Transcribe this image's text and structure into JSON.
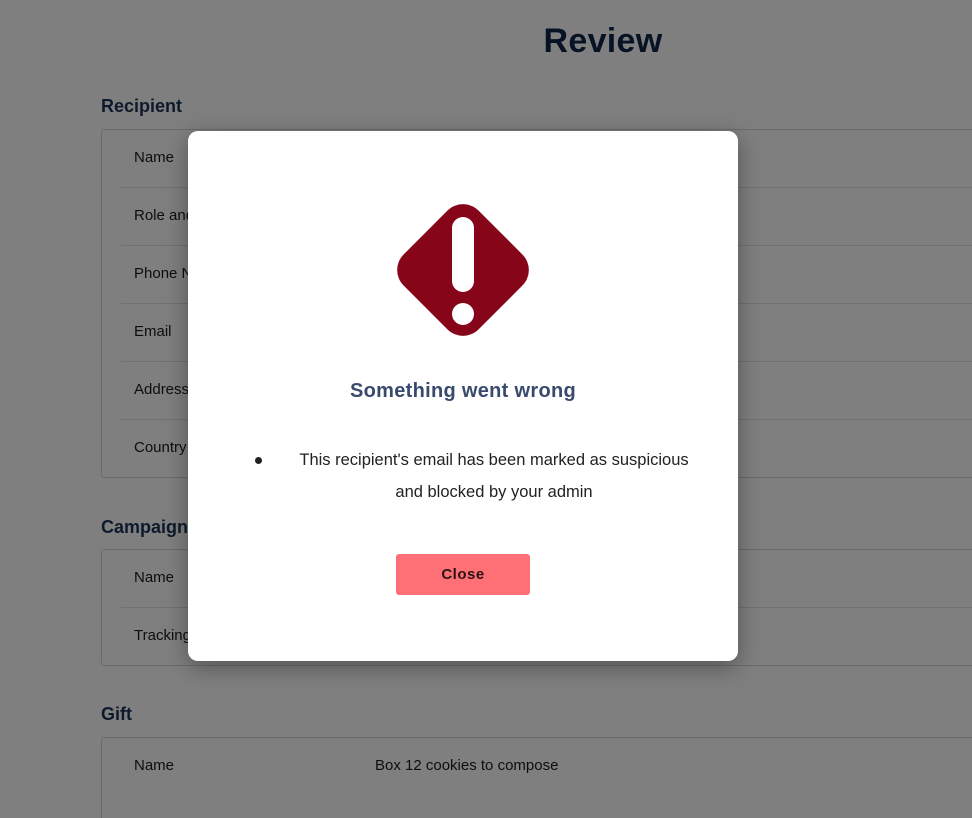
{
  "page": {
    "title": "Review"
  },
  "recipient": {
    "heading": "Recipient",
    "rows": [
      {
        "label": "Name",
        "value": ""
      },
      {
        "label": "Role and",
        "value": ""
      },
      {
        "label": "Phone N",
        "value": ""
      },
      {
        "label": "Email",
        "value": ""
      },
      {
        "label": "Address",
        "value": ""
      },
      {
        "label": "Country",
        "value": ""
      }
    ]
  },
  "campaign": {
    "heading": "Campaign",
    "rows": [
      {
        "label": "Name",
        "value": ""
      },
      {
        "label": "Tracking",
        "value": ""
      }
    ]
  },
  "gift": {
    "heading": "Gift",
    "rows": [
      {
        "label": "Name",
        "value": "Box 12 cookies to compose"
      }
    ]
  },
  "modal": {
    "icon": "warning-diamond-icon",
    "icon_color": "#870519",
    "title": "Something went wrong",
    "messages": [
      "This recipient's email has been marked as suspicious and blocked by your admin"
    ],
    "close_label": "Close",
    "close_color": "#ff6f76"
  },
  "colors": {
    "overlay": "rgba(0,0,0,0.5)",
    "title": "#0f2748",
    "section_heading": "#1d3557"
  }
}
